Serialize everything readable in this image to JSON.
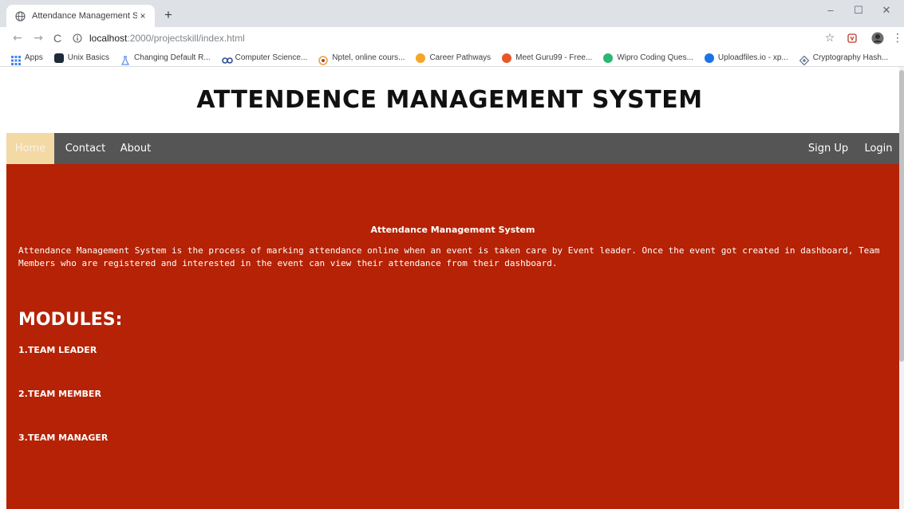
{
  "browser": {
    "tab_title": "Attendance Management System",
    "tab_close": "×",
    "new_tab": "+",
    "url_host": "localhost",
    "url_path": ":2000/projectskill/index.html",
    "window_controls": {
      "minimize": "–",
      "maximize": "☐",
      "close": "✕"
    },
    "nav": {
      "back": "←",
      "forward": "→",
      "reload": "C"
    },
    "icons": {
      "star": "☆",
      "menu": "⋮"
    },
    "bookmarks": [
      {
        "label": "Apps",
        "icon": "apps-grid-icon",
        "color": "#4285f4"
      },
      {
        "label": "Unix Basics",
        "icon": "terminal-icon",
        "color": "#1e2a38"
      },
      {
        "label": "Changing Default R...",
        "icon": "flask-icon",
        "color": "#5b8def"
      },
      {
        "label": "Computer Science...",
        "icon": "infinity-icon",
        "color": "#2d4e9a"
      },
      {
        "label": "Nptel, online cours...",
        "icon": "nptel-icon",
        "color": "#e8a33b"
      },
      {
        "label": "Career Pathways",
        "icon": "career-icon",
        "color": "#f4a52a"
      },
      {
        "label": "Meet Guru99 - Free...",
        "icon": "guru99-icon",
        "color": "#e8562a"
      },
      {
        "label": "Wipro Coding Ques...",
        "icon": "wipro-icon",
        "color": "#2bb673"
      },
      {
        "label": "Uploadfiles.io - xp...",
        "icon": "cloud-icon",
        "color": "#1a73e8"
      },
      {
        "label": "Cryptography Hash...",
        "icon": "crypto-icon",
        "color": "#6b7a8f"
      }
    ]
  },
  "page": {
    "title": "ATTENDENCE MANAGEMENT SYSTEM",
    "nav_left": [
      "Home",
      "Contact",
      "About"
    ],
    "nav_right": [
      "Sign Up",
      "Login"
    ],
    "hero_heading": "Attendance Management System",
    "hero_description": "Attendance Management System is the process of marking attendance online when an event is taken care by Event leader. Once the event got created in dashboard, Team Members who are registered and interested in the event can view their attendance from their dashboard.",
    "modules_title": "MODULES:",
    "modules": [
      "1.TEAM LEADER",
      "2.TEAM MEMBER",
      "3.TEAM MANAGER"
    ]
  },
  "colors": {
    "navbar_bg": "#555555",
    "active_nav_bg": "#f3d9a4",
    "hero_bg": "#b52205",
    "text_light": "#ffffff"
  }
}
